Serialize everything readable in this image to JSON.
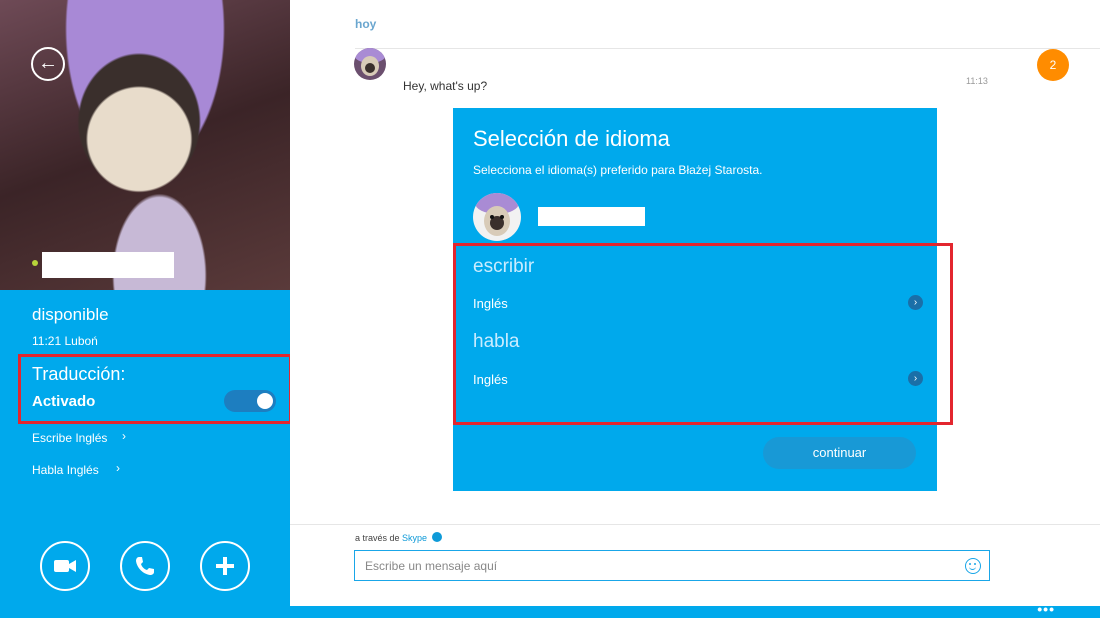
{
  "contact": {
    "status": "disponible",
    "local_time": "11:21 Luboń"
  },
  "translation": {
    "label": "Traducción:",
    "state": "Activado",
    "enabled": true
  },
  "language_links": {
    "write": "Escribe Inglés",
    "speak": "Habla Inglés"
  },
  "conversation": {
    "day_label": "hoy",
    "unread_count": "2",
    "message_text": "Hey, what's up?",
    "message_time": "11:13"
  },
  "dialog": {
    "title": "Selección de idioma",
    "subtitle": "Selecciona el idioma(s) preferido para Błażej Starosta.",
    "write_header": "escribir",
    "write_value": "Inglés",
    "speak_header": "habla",
    "speak_value": "Inglés",
    "continue_label": "continuar"
  },
  "composer": {
    "via_prefix": "a través de",
    "via_service": "Skype",
    "placeholder": "Escribe un mensaje aquí"
  },
  "colors": {
    "accent": "#00a9ec",
    "highlight_border": "#e3262e",
    "badge": "#ff8c00"
  },
  "icons": {
    "back": "back-arrow-icon",
    "video": "video-call-icon",
    "call": "phone-icon",
    "add": "plus-icon",
    "emoji": "emoji-icon",
    "more": "more-icon"
  }
}
